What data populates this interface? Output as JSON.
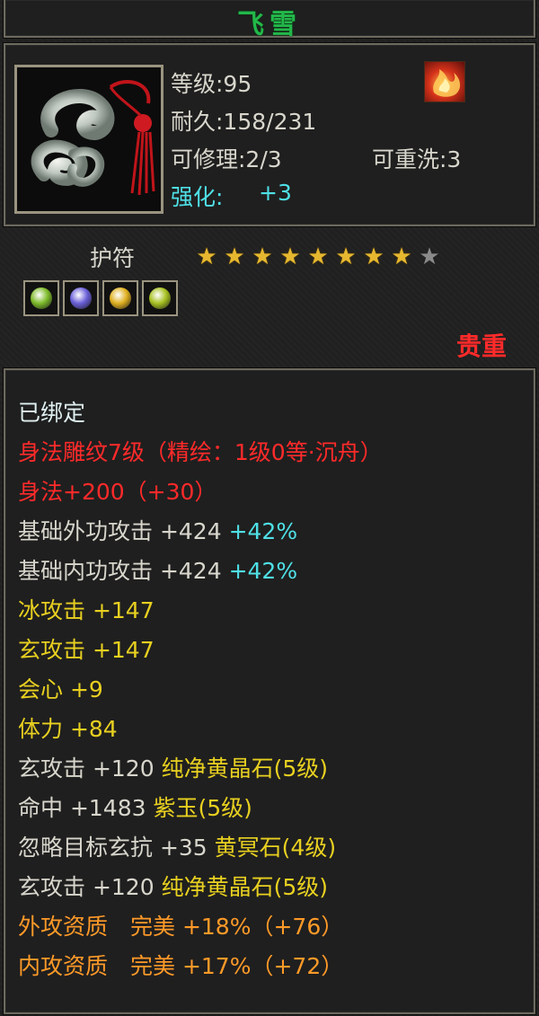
{
  "item": {
    "name": "飞雪",
    "level_label": "等级:95",
    "durability_label": "耐久:158/231",
    "repairable_label": "可修理:2/3",
    "rewash_label": "可重洗:3",
    "enhance_label": "强化:",
    "enhance_value": "+3",
    "slot_label": "护符",
    "stars": {
      "filled": 8,
      "total": 9
    },
    "rarity": "贵重",
    "gem_colors": [
      "#7dbb2a",
      "#6a5fd8",
      "#e0b020",
      "#a6c020"
    ]
  },
  "details": {
    "bound": "已绑定",
    "engrave": "身法雕纹7级（精绘：1级0等·沉舟）",
    "agility_line": "身法+200（+30）",
    "ext_attack": {
      "label": "基础外功攻击 +424",
      "pct": "+42%"
    },
    "int_attack": {
      "label": "基础内功攻击 +424",
      "pct": "+42%"
    },
    "ice_attack": "冰攻击 +147",
    "xuan_attack": "玄攻击 +147",
    "crit": "会心 +9",
    "stamina": "体力 +84",
    "gem_line_1": {
      "stat": "玄攻击 +120",
      "gem": "纯净黄晶石(5级)"
    },
    "gem_line_2": {
      "stat": "命中 +1483",
      "gem": "紫玉(5级)"
    },
    "gem_line_3": {
      "stat": "忽略目标玄抗 +35",
      "gem": "黄冥石(4级)"
    },
    "gem_line_4": {
      "stat": "玄攻击 +120",
      "gem": "纯净黄晶石(5级)"
    },
    "ext_quality": "外攻资质　完美 +18%（+76）",
    "int_quality": "内攻资质　完美 +17%（+72）"
  },
  "colors": {
    "title": "#22b84a",
    "enhance": "#4fe0e6",
    "rarity": "#ff2a2a",
    "engrave": "#ff2a2a",
    "gem": "#e8d020",
    "quality": "#ff9a28"
  }
}
